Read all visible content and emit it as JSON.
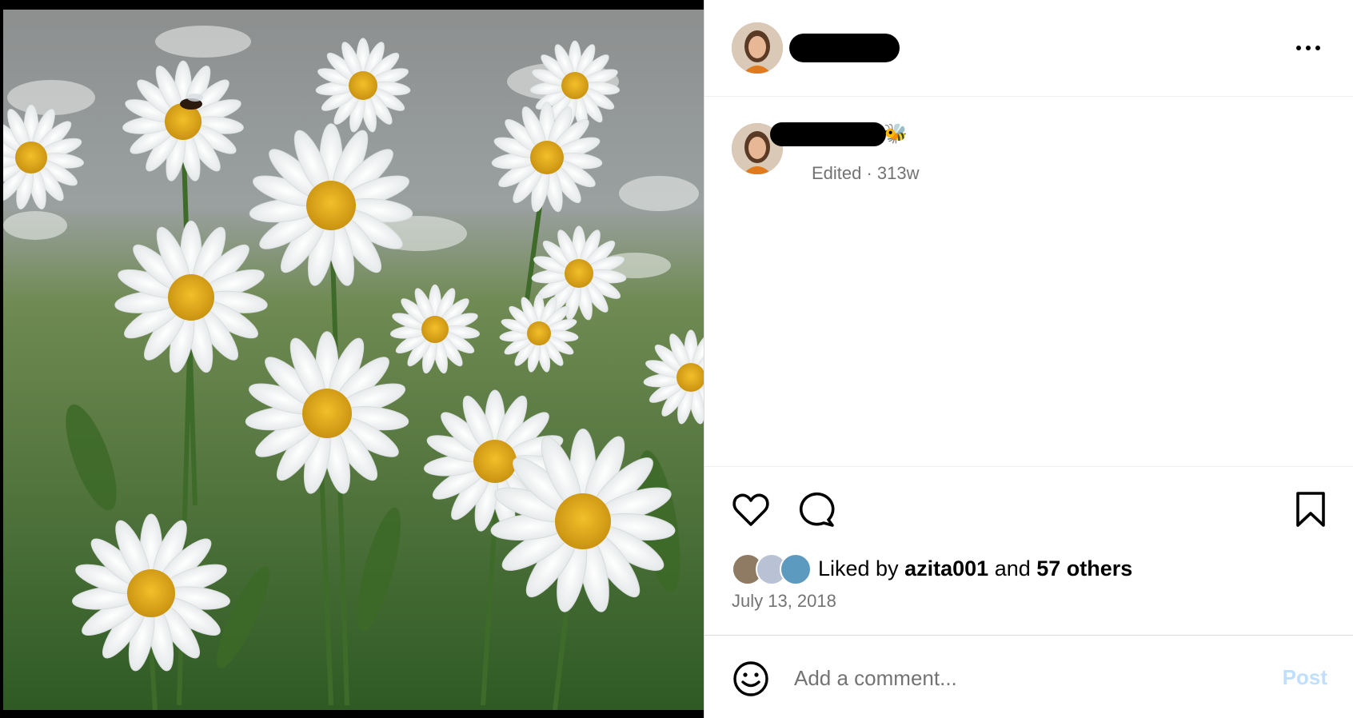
{
  "post": {
    "caption_emoji": "🐝",
    "edited_meta": "Edited · 313w",
    "more_label": "..."
  },
  "engagement": {
    "liked_by_prefix": "Liked by",
    "liked_by_user": "azita001",
    "conjunction": "and",
    "others": "57 others"
  },
  "date": "July 13, 2018",
  "comment": {
    "placeholder": "Add a comment...",
    "post_label": "Post"
  },
  "colors": {
    "accent_disabled": "#c0dffd",
    "meta_gray": "#737373",
    "divider": "#dbdbdb"
  },
  "icons": [
    "more-icon",
    "heart-icon",
    "comment-bubble-icon",
    "bookmark-icon",
    "emoji-icon"
  ]
}
